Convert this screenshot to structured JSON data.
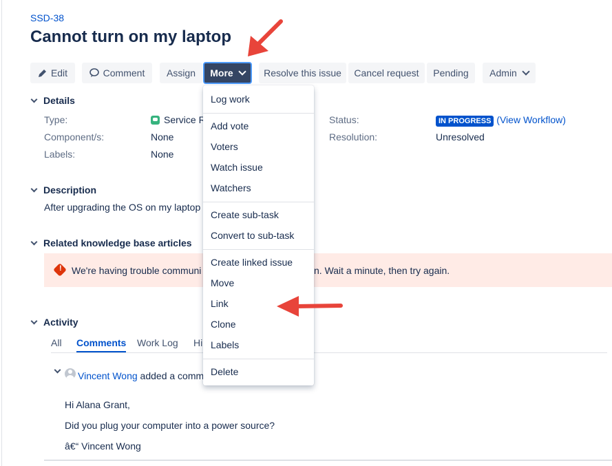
{
  "issue": {
    "key": "SSD-38",
    "title": "Cannot turn on my laptop"
  },
  "toolbar": {
    "edit": "Edit",
    "comment": "Comment",
    "assign": "Assign",
    "more": "More",
    "resolve": "Resolve this issue",
    "cancel": "Cancel request",
    "pending": "Pending",
    "admin": "Admin"
  },
  "details": {
    "heading": "Details",
    "type_label": "Type:",
    "type_value": "Service Re",
    "components_label": "Component/s:",
    "components_value": "None",
    "labels_label": "Labels:",
    "labels_value": "None",
    "status_label": "Status:",
    "status_value": "IN PROGRESS",
    "status_link": "(View Workflow)",
    "resolution_label": "Resolution:",
    "resolution_value": "Unresolved"
  },
  "description": {
    "heading": "Description",
    "text": "After upgrading the OS on my laptop"
  },
  "kb": {
    "heading": "Related knowledge base articles",
    "error_start": "We're having trouble communi",
    "error_end": "n. Wait a minute, then try again."
  },
  "activity": {
    "heading": "Activity",
    "tabs": [
      "All",
      "Comments",
      "Work Log",
      "Hi"
    ],
    "comment_author": "Vincent Wong",
    "comment_action": "added a comm",
    "comment_lines": [
      "Hi Alana Grant,",
      "Did you plug your computer into a power source?",
      "â€“ Vincent Wong"
    ]
  },
  "more_menu": {
    "groups": [
      [
        "Log work"
      ],
      [
        "Add vote",
        "Voters",
        "Watch issue",
        "Watchers"
      ],
      [
        "Create sub-task",
        "Convert to sub-task"
      ],
      [
        "Create linked issue",
        "Move",
        "Link",
        "Clone",
        "Labels"
      ],
      [
        "Delete"
      ]
    ]
  },
  "colors": {
    "accent": "#0052cc",
    "arrow": "#e8443a",
    "more_button": "#344563",
    "error_bg": "#ffebe6"
  },
  "icons": [
    "pencil-icon",
    "comment-bubble-icon",
    "chevron-down-icon",
    "service-request-icon",
    "error-icon",
    "avatar-icon"
  ]
}
